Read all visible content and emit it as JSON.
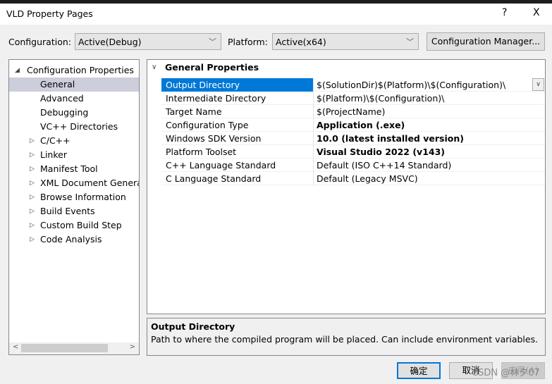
{
  "window": {
    "title": "VLD Property Pages",
    "help": "?",
    "close": "X"
  },
  "toolbar": {
    "configuration_label": "Configuration:",
    "configuration_value": "Active(Debug)",
    "platform_label": "Platform:",
    "platform_value": "Active(x64)",
    "config_manager": "Configuration Manager..."
  },
  "tree": {
    "root": "Configuration Properties",
    "items": [
      {
        "label": "General",
        "selected": true,
        "expandable": false
      },
      {
        "label": "Advanced",
        "expandable": false
      },
      {
        "label": "Debugging",
        "expandable": false
      },
      {
        "label": "VC++ Directories",
        "expandable": false
      },
      {
        "label": "C/C++",
        "expandable": true
      },
      {
        "label": "Linker",
        "expandable": true
      },
      {
        "label": "Manifest Tool",
        "expandable": true
      },
      {
        "label": "XML Document Generat",
        "expandable": true
      },
      {
        "label": "Browse Information",
        "expandable": true
      },
      {
        "label": "Build Events",
        "expandable": true
      },
      {
        "label": "Custom Build Step",
        "expandable": true
      },
      {
        "label": "Code Analysis",
        "expandable": true
      }
    ]
  },
  "grid": {
    "section": "General Properties",
    "rows": [
      {
        "name": "Output Directory",
        "value": "$(SolutionDir)$(Platform)\\$(Configuration)\\",
        "bold": false
      },
      {
        "name": "Intermediate Directory",
        "value": "$(Platform)\\$(Configuration)\\",
        "bold": false
      },
      {
        "name": "Target Name",
        "value": "$(ProjectName)",
        "bold": false
      },
      {
        "name": "Configuration Type",
        "value": "Application (.exe)",
        "bold": true
      },
      {
        "name": "Windows SDK Version",
        "value": "10.0 (latest installed version)",
        "bold": true
      },
      {
        "name": "Platform Toolset",
        "value": "Visual Studio 2022 (v143)",
        "bold": true
      },
      {
        "name": "C++ Language Standard",
        "value": "Default (ISO C++14 Standard)",
        "bold": false
      },
      {
        "name": "C Language Standard",
        "value": "Default (Legacy MSVC)",
        "bold": false
      }
    ]
  },
  "description": {
    "title": "Output Directory",
    "text": "Path to where the compiled program will be placed. Can include environment variables."
  },
  "buttons": {
    "ok": "确定",
    "cancel": "取消",
    "apply": "应用(A)"
  },
  "watermark": "CSDN @林夕07",
  "colors": {
    "selection": "#0078d7",
    "tree_selection": "#cccedb"
  }
}
